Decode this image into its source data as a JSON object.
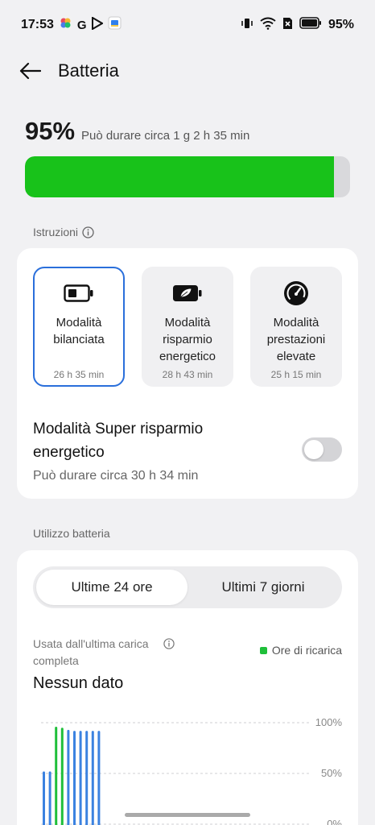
{
  "status_bar": {
    "time": "17:53",
    "g_label": "G",
    "battery_pct": "95%",
    "icons": [
      "photos-icon",
      "g-icon",
      "play-store-icon",
      "files-icon",
      "vibrate-icon",
      "wifi-icon",
      "sim-off-icon",
      "battery-icon"
    ]
  },
  "header": {
    "title": "Batteria"
  },
  "battery": {
    "percent_text": "95%",
    "percent_value": 95,
    "estimate": "Può durare circa 1 g 2 h 35 min",
    "fill_color": "#18c21a"
  },
  "sections": {
    "instructions": "Istruzioni",
    "usage": "Utilizzo batteria"
  },
  "modes": [
    {
      "label": "Modalità bilanciata",
      "time": "26 h 35 min",
      "icon": "battery-half-icon",
      "selected": true
    },
    {
      "label": "Modalità risparmio energetico",
      "time": "28 h 43 min",
      "icon": "battery-leaf-icon",
      "selected": false
    },
    {
      "label": "Modalità prestazioni elevate",
      "time": "25 h 15 min",
      "icon": "speedometer-icon",
      "selected": false
    }
  ],
  "super_saver": {
    "title": "Modalità Super risparmio energetico",
    "subtitle": "Può durare circa 30 h 34 min",
    "enabled": false
  },
  "usage": {
    "tabs": [
      "Ultime 24 ore",
      "Ultimi 7 giorni"
    ],
    "active_tab": 0,
    "used_label": "Usata dall'ultima carica completa",
    "legend": "Ore di ricarica",
    "no_data": "Nessun dato"
  },
  "chart_data": {
    "type": "bar",
    "y_ticks": [
      "100%",
      "50%",
      "0%"
    ],
    "ylim": [
      0,
      100
    ],
    "series": [
      {
        "values": [
          52,
          52,
          null,
          null,
          93,
          92,
          92,
          92,
          92,
          92
        ]
      },
      {
        "name": "Ore di ricarica",
        "values": [
          null,
          null,
          96,
          95,
          null,
          null,
          null,
          null,
          null,
          null
        ]
      }
    ],
    "colors": {
      "usage": "#3b82e0",
      "charging": "#1fbf3a"
    }
  }
}
